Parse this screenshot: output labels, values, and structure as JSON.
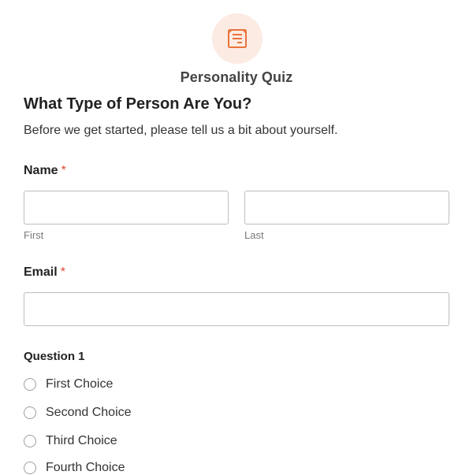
{
  "brand": {
    "icon": "form-list-icon",
    "accent_color": "#e8733a",
    "icon_bg_color": "#fcebe3",
    "name": "Personality Quiz"
  },
  "form": {
    "title": "What Type of Person Are You?",
    "description": "Before we get started, please tell us a bit about yourself."
  },
  "name_field": {
    "label": "Name",
    "required_marker": "*",
    "first_value": "",
    "last_value": "",
    "first_sublabel": "First",
    "last_sublabel": "Last"
  },
  "email_field": {
    "label": "Email",
    "required_marker": "*",
    "value": ""
  },
  "question1": {
    "label": "Question 1",
    "choices": [
      "First Choice",
      "Second Choice",
      "Third Choice",
      "Fourth Choice"
    ]
  },
  "colors": {
    "required": "#e0463b",
    "input_border": "#bdbdbd"
  }
}
